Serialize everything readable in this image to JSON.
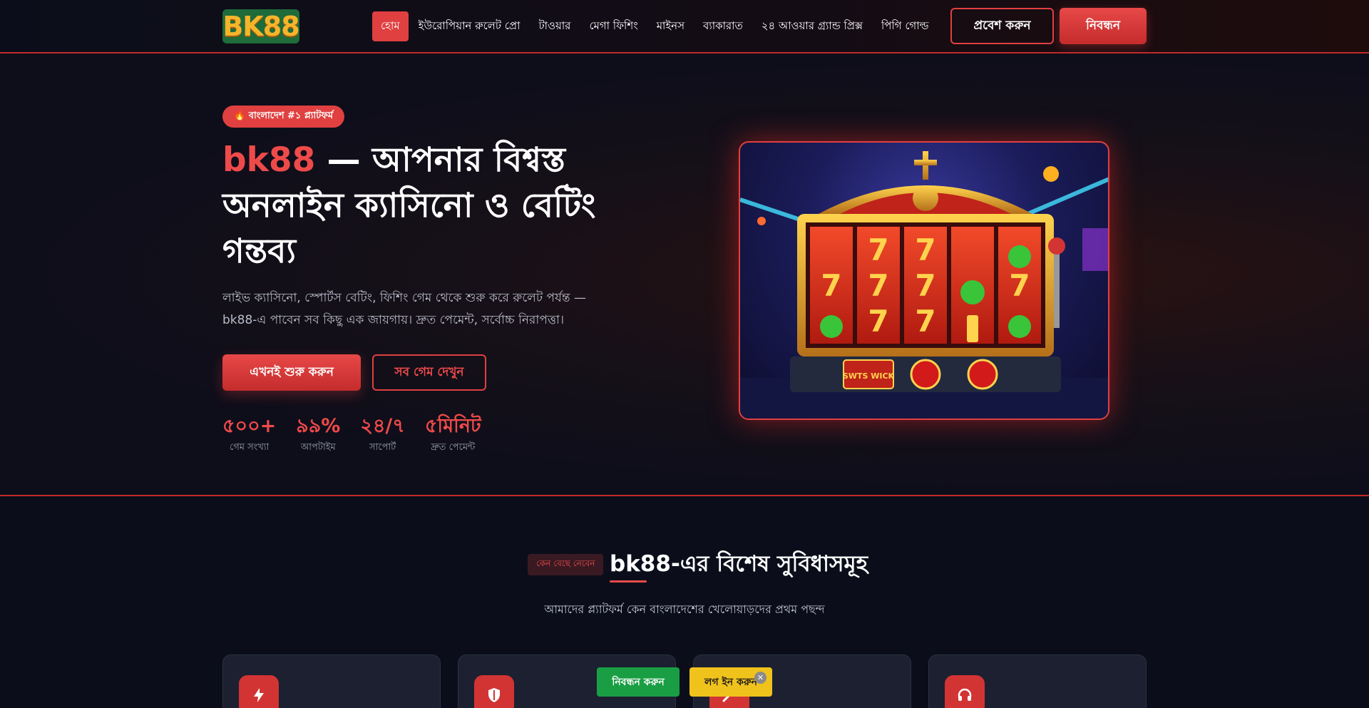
{
  "header": {
    "logo_text": "BK88",
    "nav": [
      {
        "label": "হোম",
        "active": true
      },
      {
        "label": "ইউরোপিয়ান রুলেট প্রো",
        "active": false
      },
      {
        "label": "টাওয়ার",
        "active": false
      },
      {
        "label": "মেগা ফিশিং",
        "active": false
      },
      {
        "label": "মাইনস",
        "active": false
      },
      {
        "label": "ব্যাকারাত",
        "active": false
      },
      {
        "label": "২৪ আওয়ার গ্র্যান্ড প্রিক্স",
        "active": false
      },
      {
        "label": "পিগি গোল্ড",
        "active": false
      }
    ],
    "login_label": "প্রবেশ করুন",
    "register_label": "নিবন্ধন"
  },
  "hero": {
    "badge": "🔥 বাংলাদেশ #১ প্ল্যাটফর্ম",
    "title_brand": "bk88",
    "title_rest": " — আপনার বিশ্বস্ত অনলাইন ক্যাসিনো ও বেটিং গন্তব্য",
    "description": "লাইভ ক্যাসিনো, স্পোর্টস বেটিং, ফিশিং গেম থেকে শুরু করে রুলেট পর্যন্ত — bk88-এ পাবেন সব কিছু এক জায়গায়। দ্রুত পেমেন্ট, সর্বোচ্চ নিরাপত্তা।",
    "start_label": "এখনই শুরু করুন",
    "games_label": "সব গেম দেখুন",
    "stats": [
      {
        "value": "৫০০+",
        "label": "গেম সংখ্যা"
      },
      {
        "value": "৯৯%",
        "label": "আপটাইম"
      },
      {
        "value": "২৪/৭",
        "label": "সাপোর্ট"
      },
      {
        "value": "৫মিনিট",
        "label": "দ্রুত পেমেন্ট"
      }
    ],
    "slot_reel_text": "SWTS WICK"
  },
  "features": {
    "tag": "কেন বেছে নেবেন",
    "title": "bk88-এর বিশেষ সুবিধাসমূহ",
    "subtitle": "আমাদের প্ল্যাটফর্ম কেন বাংলাদেশের খেলোয়াড়দের প্রথম পছন্দ",
    "cards": [
      {
        "icon": "lightning-icon"
      },
      {
        "icon": "shield-icon"
      },
      {
        "icon": "tool-icon"
      },
      {
        "icon": "headset-icon"
      }
    ]
  },
  "floating": {
    "register_label": "নিবন্ধন করুন",
    "login_label": "লগ ইন করুন",
    "close_label": "✕"
  },
  "colors": {
    "accent": "#e04040",
    "background": "#0b0e1a",
    "register_green": "#1a9e44",
    "login_yellow": "#f0c21c"
  }
}
